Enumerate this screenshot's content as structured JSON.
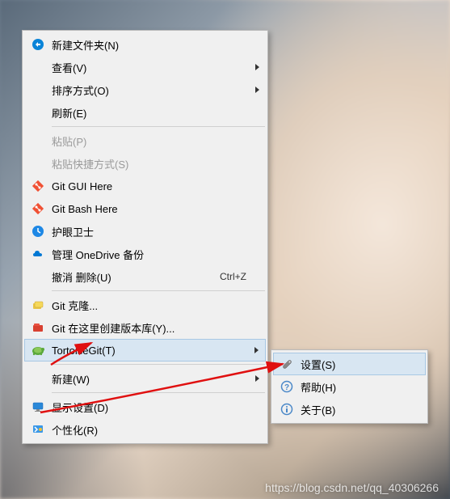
{
  "menu": {
    "items": [
      {
        "id": "new-folder",
        "label": "新建文件夹(N)",
        "icon": "circle-arrow"
      },
      {
        "id": "view",
        "label": "查看(V)",
        "submenu": true
      },
      {
        "id": "sort",
        "label": "排序方式(O)",
        "submenu": true
      },
      {
        "id": "refresh",
        "label": "刷新(E)"
      },
      {
        "sep": true
      },
      {
        "id": "paste",
        "label": "粘贴(P)",
        "disabled": true
      },
      {
        "id": "paste-shortcut",
        "label": "粘贴快捷方式(S)",
        "disabled": true
      },
      {
        "id": "git-gui",
        "label": "Git GUI Here",
        "icon": "git-diamond"
      },
      {
        "id": "git-bash",
        "label": "Git Bash Here",
        "icon": "git-diamond"
      },
      {
        "id": "huyan",
        "label": "护眼卫士",
        "icon": "blue-circle"
      },
      {
        "id": "onedrive",
        "label": "管理 OneDrive 备份",
        "icon": "cloud"
      },
      {
        "id": "undo-delete",
        "label": "撤消 删除(U)",
        "shortcut": "Ctrl+Z"
      },
      {
        "sep": true
      },
      {
        "id": "git-clone",
        "label": "Git 克隆...",
        "icon": "tgit-yellow"
      },
      {
        "id": "git-create",
        "label": "Git 在这里创建版本库(Y)...",
        "icon": "tgit-red"
      },
      {
        "id": "tortoisegit",
        "label": "TortoiseGit(T)",
        "icon": "tortoise",
        "submenu": true,
        "hover": true
      },
      {
        "sep": true
      },
      {
        "id": "new",
        "label": "新建(W)",
        "submenu": true
      },
      {
        "sep": true
      },
      {
        "id": "display",
        "label": "显示设置(D)",
        "icon": "monitor"
      },
      {
        "id": "personalize",
        "label": "个性化(R)",
        "icon": "paint"
      }
    ]
  },
  "submenu": {
    "items": [
      {
        "id": "settings",
        "label": "设置(S)",
        "icon": "wrench",
        "hover": true
      },
      {
        "id": "help",
        "label": "帮助(H)",
        "icon": "question"
      },
      {
        "id": "about",
        "label": "关于(B)",
        "icon": "info"
      }
    ]
  },
  "watermark": "https://blog.csdn.net/qq_40306266"
}
